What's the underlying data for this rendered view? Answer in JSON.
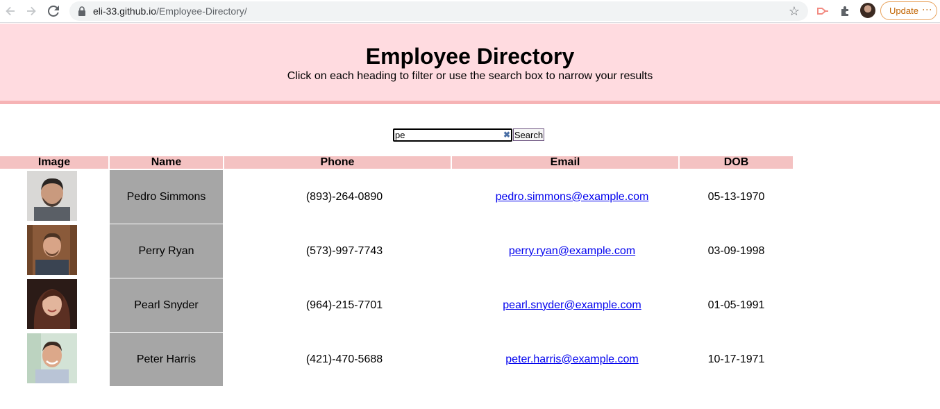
{
  "browser": {
    "url_host": "eli-33.github.io",
    "url_path": "/Employee-Directory/",
    "update_label": "Update"
  },
  "header": {
    "title": "Employee Directory",
    "subtitle": "Click on each heading to filter or use the search box to narrow your results"
  },
  "search": {
    "value": "pe",
    "button_label": "Search"
  },
  "table": {
    "columns": [
      "Image",
      "Name",
      "Phone",
      "Email",
      "DOB"
    ],
    "rows": [
      {
        "name": "Pedro Simmons",
        "phone": "(893)-264-0890",
        "email": "pedro.simmons@example.com",
        "dob": "05-13-1970",
        "photo": "man-short-dark-hair-beard"
      },
      {
        "name": "Perry Ryan",
        "phone": "(573)-997-7743",
        "email": "perry.ryan@example.com",
        "dob": "03-09-1998",
        "photo": "man-wood-background"
      },
      {
        "name": "Pearl Snyder",
        "phone": "(964)-215-7701",
        "email": "pearl.snyder@example.com",
        "dob": "01-05-1991",
        "photo": "woman-brown-hair"
      },
      {
        "name": "Peter Harris",
        "phone": "(421)-470-5688",
        "email": "peter.harris@example.com",
        "dob": "10-17-1971",
        "photo": "man-smiling-light-background"
      }
    ]
  },
  "colors": {
    "header_bg": "#ffdbe0",
    "header_border": "#f6b3b5",
    "table_header_bg": "#f4c2c2",
    "name_cell_bg": "#a6a6a6",
    "link": "#0000ee"
  }
}
